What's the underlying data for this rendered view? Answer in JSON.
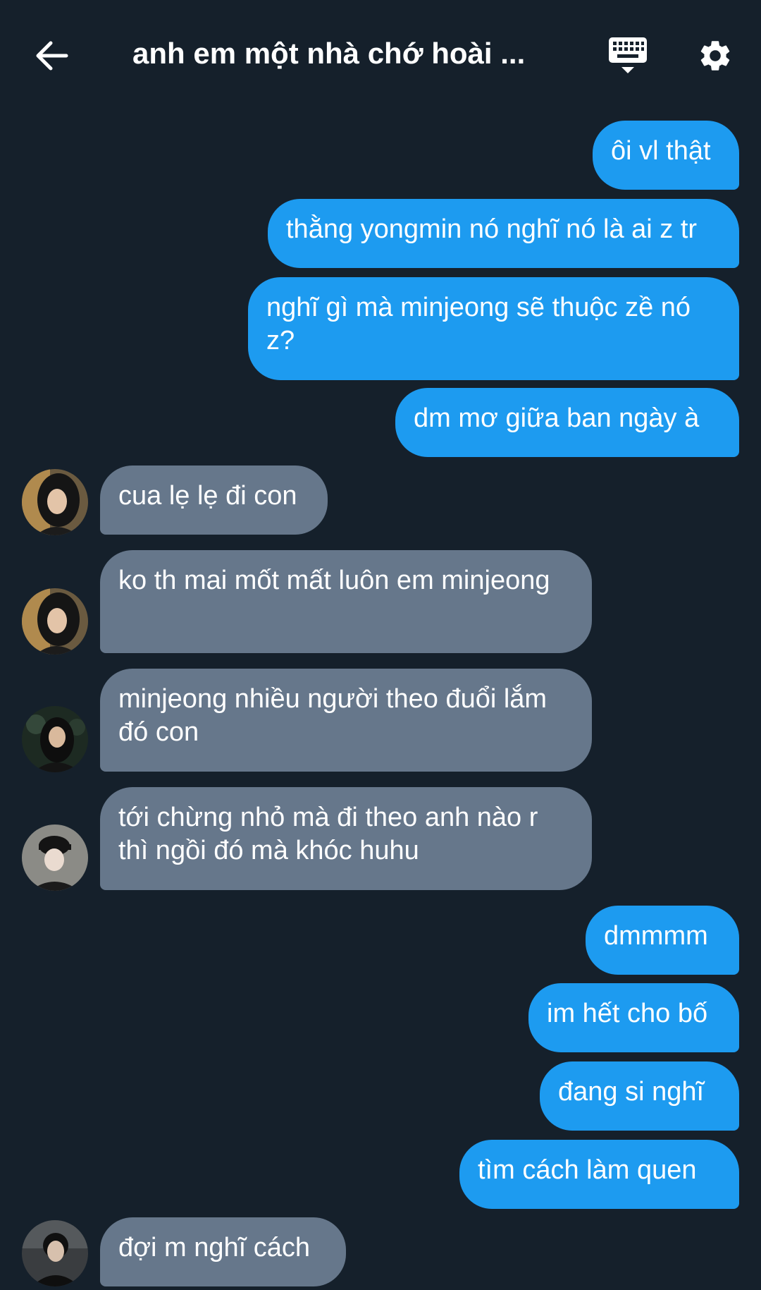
{
  "header": {
    "title": "anh em một nhà chớ hoài ...",
    "back_icon": "arrow-left-icon",
    "keyboard_icon": "keyboard-icon",
    "settings_icon": "gear-icon"
  },
  "colors": {
    "background": "#15202b",
    "sent_bubble": "#1d9bf0",
    "received_bubble": "#66778b",
    "text": "#ffffff"
  },
  "messages": [
    {
      "side": "sent",
      "text": "ôi vl thật"
    },
    {
      "side": "sent",
      "text": "thằng yongmin nó nghĩ nó là ai z tr"
    },
    {
      "side": "sent",
      "text": "nghĩ gì mà minjeong sẽ thuộc zề nó z?"
    },
    {
      "side": "sent",
      "text": "dm mơ giữa ban ngày à"
    },
    {
      "side": "received",
      "text": "cua lẹ lẹ đi con",
      "avatar": "avatar-girl-long-hair"
    },
    {
      "side": "received",
      "text": "ko th mai mốt mất luôn em minjeong",
      "avatar": "avatar-girl-long-hair"
    },
    {
      "side": "received",
      "text": "minjeong nhiều người theo đuổi lắm đó con",
      "avatar": "avatar-girl-dark-background"
    },
    {
      "side": "received",
      "text": "tới chừng nhỏ mà đi theo anh nào r thì ngồi đó mà khóc huhu",
      "avatar": "avatar-girl-cap"
    },
    {
      "side": "sent",
      "text": "dmmmm"
    },
    {
      "side": "sent",
      "text": "im hết cho bố"
    },
    {
      "side": "sent",
      "text": "đang si nghĩ"
    },
    {
      "side": "sent",
      "text": "tìm cách làm quen"
    },
    {
      "side": "received",
      "text": "đợi m nghĩ cách",
      "avatar": "avatar-boy-dark"
    }
  ]
}
